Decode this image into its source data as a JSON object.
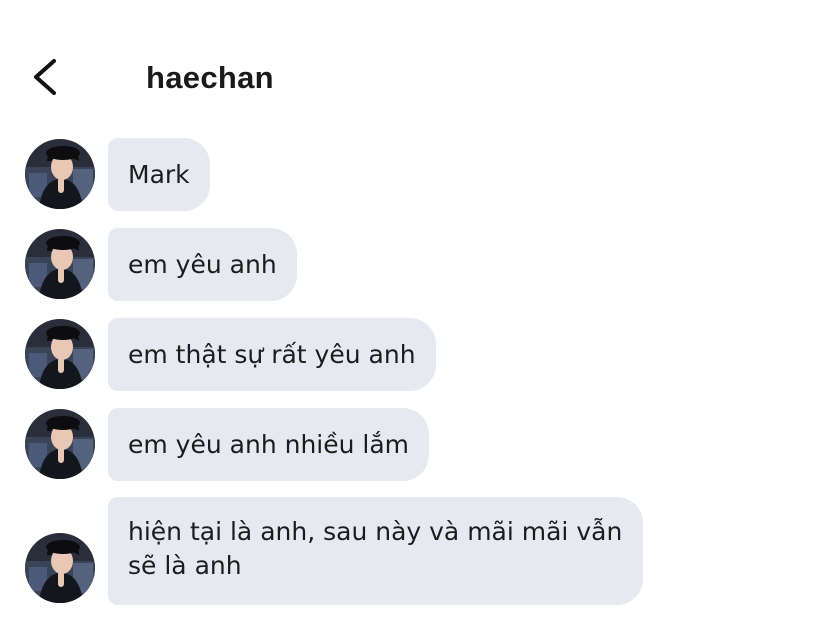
{
  "header": {
    "back_icon": "chevron-left-icon",
    "title": "haechan"
  },
  "messages": [
    {
      "text": "Mark"
    },
    {
      "text": "em yêu anh"
    },
    {
      "text": "em thật sự rất yêu anh"
    },
    {
      "text": "em yêu anh nhiều lắm"
    },
    {
      "text": "hiện tại là anh, sau này và mãi mãi vẫn sẽ là anh"
    }
  ],
  "colors": {
    "bubble_background": "#e6eaf0",
    "text": "#1c1c1c",
    "background": "#ffffff"
  }
}
